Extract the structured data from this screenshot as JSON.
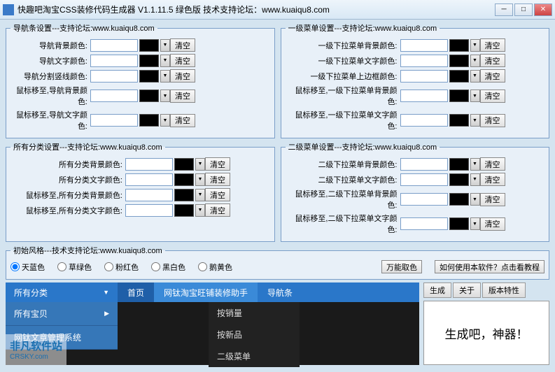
{
  "window": {
    "title": "快趣吧淘宝CSS装修代码生成器 V1.1.11.5 绿色版   技术支持论坛：www.kuaiqu8.com"
  },
  "groups": {
    "nav": {
      "legend": "导航条设置---支持论坛:www.kuaiqu8.com",
      "rows": [
        "导航背景颜色:",
        "导航文字颜色:",
        "导航分割竖线颜色:",
        "鼠标移至,导航背景颜色:",
        "鼠标移至,导航文字颜色:"
      ]
    },
    "menu1": {
      "legend": "一级菜单设置---支持论坛:www.kuaiqu8.com",
      "rows": [
        "一级下拉菜单背景颜色:",
        "一级下拉菜单文字颜色:",
        "一级下拉菜单上边框颜色:",
        "鼠标移至,一级下拉菜单背景颜色:",
        "鼠标移至,一级下拉菜单文字颜色:"
      ]
    },
    "cat": {
      "legend": "所有分类设置---支持论坛:www.kuaiqu8.com",
      "rows": [
        "所有分类背景颜色:",
        "所有分类文字颜色:",
        "鼠标移至,所有分类背景颜色:",
        "鼠标移至,所有分类文字颜色:"
      ]
    },
    "menu2": {
      "legend": "二级菜单设置---支持论坛:www.kuaiqu8.com",
      "rows": [
        "二级下拉菜单背景颜色:",
        "二级下拉菜单文字颜色:",
        "鼠标移至,二级下拉菜单背景颜色:",
        "鼠标移至,二级下拉菜单文字颜色:"
      ]
    }
  },
  "clear": "清空",
  "style": {
    "legend": "初始风格---技术支持论坛:www.kuaiqu8.com",
    "options": [
      "天蓝色",
      "草绿色",
      "粉红色",
      "黑白色",
      "鹅黄色"
    ],
    "btn_pick": "万能取色",
    "btn_help": "如何使用本软件？点击看教程"
  },
  "preview": {
    "allcat": "所有分类",
    "home": "首页",
    "helper": "网钛淘宝旺铺装修助手",
    "navbar": "导航条",
    "allbaby": "所有宝贝",
    "sys": "网钛文章管理系统",
    "dd": [
      "按销量",
      "按新品",
      "二级菜单"
    ]
  },
  "tabs": {
    "gen": "生成",
    "about": "关于",
    "ver": "版本特性"
  },
  "bigtext": "生成吧，神器！",
  "wm": {
    "name": "非凡软件站",
    "url": "CRSKY.com"
  }
}
